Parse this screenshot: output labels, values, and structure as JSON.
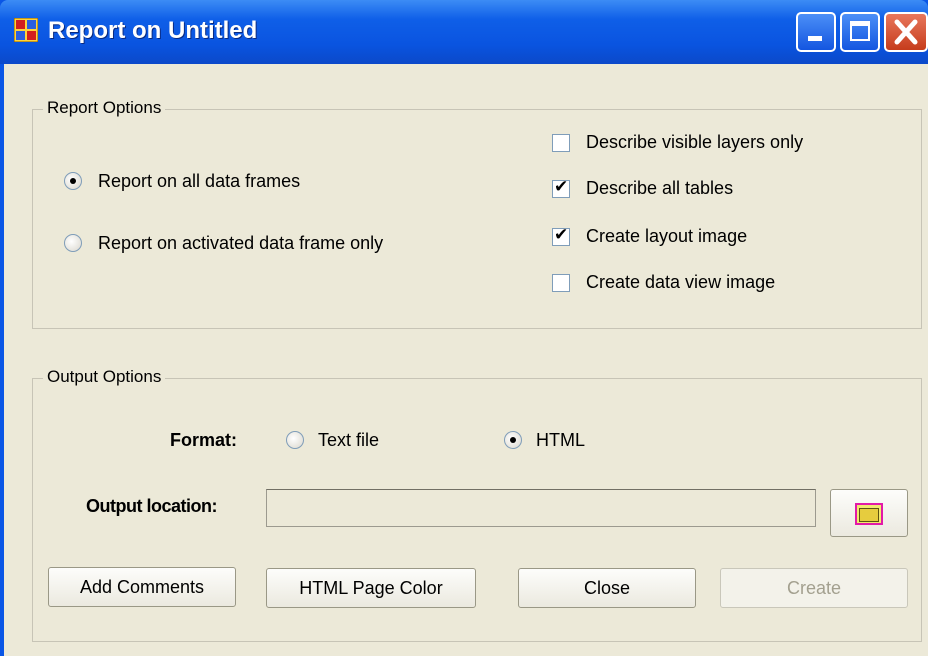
{
  "window": {
    "title": "Report on Untitled",
    "icon": "report-app-icon",
    "controls": [
      "minimize",
      "maximize",
      "close"
    ]
  },
  "report_options": {
    "legend": "Report Options",
    "radios": [
      {
        "label": "Report on all data frames",
        "selected": true
      },
      {
        "label": "Report on activated data frame only",
        "selected": false
      }
    ],
    "checkboxes": [
      {
        "label": "Describe visible layers only",
        "checked": false
      },
      {
        "label": "Describe all tables",
        "checked": true
      },
      {
        "label": "Create layout image",
        "checked": true
      },
      {
        "label": "Create data view image",
        "checked": false
      }
    ]
  },
  "output_options": {
    "legend": "Output Options",
    "format_label": "Format:",
    "format_options": [
      {
        "label": "Text file",
        "selected": false
      },
      {
        "label": "HTML",
        "selected": true
      }
    ],
    "location_label": "Output location:",
    "location_value": "",
    "browse_icon": "folder-icon"
  },
  "buttons": {
    "add_comments": "Add Comments",
    "page_color": "HTML Page Color",
    "close": "Close",
    "create": "Create"
  },
  "colors": {
    "titlebar": "#0a56e6",
    "dialog_bg": "#ece9d8",
    "disabled_text": "#a3a08f"
  }
}
